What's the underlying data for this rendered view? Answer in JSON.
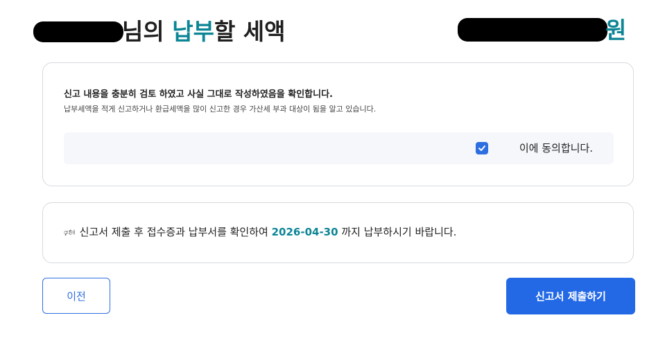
{
  "header": {
    "title_suffix_1": "님의 ",
    "title_highlight": "납부",
    "title_suffix_2": "할 세액",
    "currency": "원"
  },
  "confirm": {
    "title": "신고 내용을 충분히 검토 하였고 사실 그대로 작성하였음을 확인합니다.",
    "description": "납부세액을 적게 신고하거나 환급세액을 많이 신고한 경우 가산세 부과 대상이 됨을 알고 있습니다.",
    "agree_label": "이에 동의합니다.",
    "agree_checked": true
  },
  "notice": {
    "icon": "speaker-icon",
    "text_before": "신고서 제출 후 접수증과 납부서를 확인하여 ",
    "due_date": "2026-04-30",
    "text_after": " 까지 납부하시기 바랍니다."
  },
  "buttons": {
    "prev_label": "이전",
    "submit_label": "신고서 제출하기"
  },
  "colors": {
    "accent_teal": "#0c8595",
    "primary_blue": "#2369e6"
  }
}
